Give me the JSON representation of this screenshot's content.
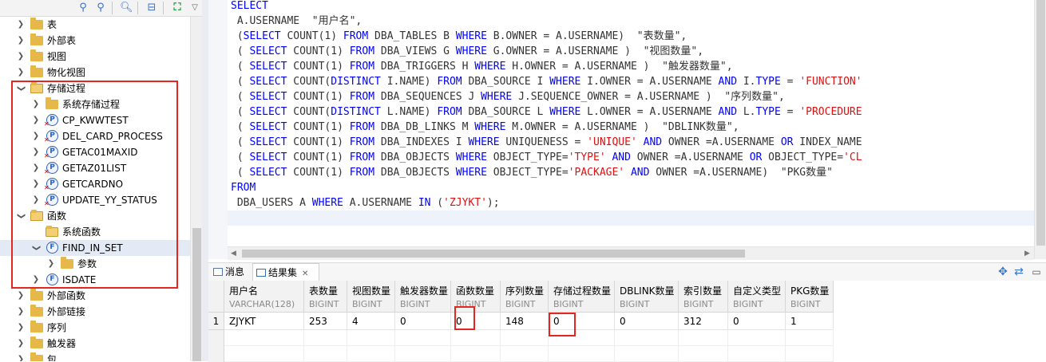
{
  "tree": {
    "items": [
      {
        "label": "表",
        "icon": "folder-icon",
        "expanded": false
      },
      {
        "label": "外部表",
        "icon": "folder-icon",
        "expanded": false
      },
      {
        "label": "视图",
        "icon": "folder-icon",
        "expanded": false
      },
      {
        "label": "物化视图",
        "icon": "folder-icon",
        "expanded": false
      },
      {
        "label": "存储过程",
        "icon": "folder-open-icon",
        "expanded": true
      },
      {
        "label": "系统存储过程",
        "icon": "folder-icon",
        "expanded": false
      },
      {
        "label": "CP_KWWTEST",
        "icon": "procedure-error-icon",
        "expanded": false
      },
      {
        "label": "DEL_CARD_PROCESS",
        "icon": "procedure-error-icon",
        "expanded": false
      },
      {
        "label": "GETAC01MAXID",
        "icon": "procedure-error-icon",
        "expanded": false
      },
      {
        "label": "GETAZ01LIST",
        "icon": "procedure-error-icon",
        "expanded": false
      },
      {
        "label": "GETCARDNO",
        "icon": "procedure-error-icon",
        "expanded": false
      },
      {
        "label": "UPDATE_YY_STATUS",
        "icon": "procedure-error-icon",
        "expanded": false
      },
      {
        "label": "函数",
        "icon": "folder-open-icon",
        "expanded": true
      },
      {
        "label": "系统函数",
        "icon": "folder-open-icon",
        "expanded": false
      },
      {
        "label": "FIND_IN_SET",
        "icon": "function-icon",
        "expanded": true,
        "selected": true
      },
      {
        "label": "参数",
        "icon": "folder-icon",
        "expanded": false
      },
      {
        "label": "ISDATE",
        "icon": "function-icon",
        "expanded": false
      },
      {
        "label": "外部函数",
        "icon": "folder-icon",
        "expanded": false
      },
      {
        "label": "外部链接",
        "icon": "folder-icon",
        "expanded": false
      },
      {
        "label": "序列",
        "icon": "folder-icon",
        "expanded": false
      },
      {
        "label": "触发器",
        "icon": "folder-icon",
        "expanded": false
      },
      {
        "label": "包",
        "icon": "folder-icon",
        "expanded": false
      }
    ]
  },
  "sql": {
    "lines": [
      [
        {
          "k": "kw",
          "t": "SELECT"
        }
      ],
      [
        {
          "k": "txt",
          "t": " A.USERNAME  \"用户名\","
        }
      ],
      [
        {
          "k": "txt",
          "t": " ("
        },
        {
          "k": "kw",
          "t": "SELECT"
        },
        {
          "k": "txt",
          "t": " COUNT(1) "
        },
        {
          "k": "kw",
          "t": "FROM"
        },
        {
          "k": "txt",
          "t": " DBA_TABLES B "
        },
        {
          "k": "kw",
          "t": "WHERE"
        },
        {
          "k": "txt",
          "t": " B.OWNER = A.USERNAME)  \"表数量\","
        }
      ],
      [
        {
          "k": "txt",
          "t": " ( "
        },
        {
          "k": "kw",
          "t": "SELECT"
        },
        {
          "k": "txt",
          "t": " COUNT(1) "
        },
        {
          "k": "kw",
          "t": "FROM"
        },
        {
          "k": "txt",
          "t": " DBA_VIEWS G "
        },
        {
          "k": "kw",
          "t": "WHERE"
        },
        {
          "k": "txt",
          "t": " G.OWNER = A.USERNAME )  \"视图数量\","
        }
      ],
      [
        {
          "k": "txt",
          "t": " ( "
        },
        {
          "k": "kw",
          "t": "SELECT"
        },
        {
          "k": "txt",
          "t": " COUNT(1) "
        },
        {
          "k": "kw",
          "t": "FROM"
        },
        {
          "k": "txt",
          "t": " DBA_TRIGGERS H "
        },
        {
          "k": "kw",
          "t": "WHERE"
        },
        {
          "k": "txt",
          "t": " H.OWNER = A.USERNAME )  \"触发器数量\","
        }
      ],
      [
        {
          "k": "txt",
          "t": " ( "
        },
        {
          "k": "kw",
          "t": "SELECT"
        },
        {
          "k": "txt",
          "t": " COUNT("
        },
        {
          "k": "kw",
          "t": "DISTINCT"
        },
        {
          "k": "txt",
          "t": " I.NAME) "
        },
        {
          "k": "kw",
          "t": "FROM"
        },
        {
          "k": "txt",
          "t": " DBA_SOURCE I "
        },
        {
          "k": "kw",
          "t": "WHERE"
        },
        {
          "k": "txt",
          "t": " I.OWNER = A.USERNAME "
        },
        {
          "k": "kw",
          "t": "AND"
        },
        {
          "k": "txt",
          "t": " I."
        },
        {
          "k": "kw",
          "t": "TYPE"
        },
        {
          "k": "txt",
          "t": " = "
        },
        {
          "k": "str",
          "t": "'FUNCTION'"
        }
      ],
      [
        {
          "k": "txt",
          "t": " ( "
        },
        {
          "k": "kw",
          "t": "SELECT"
        },
        {
          "k": "txt",
          "t": " COUNT(1) "
        },
        {
          "k": "kw",
          "t": "FROM"
        },
        {
          "k": "txt",
          "t": " DBA_SEQUENCES J "
        },
        {
          "k": "kw",
          "t": "WHERE"
        },
        {
          "k": "txt",
          "t": " J.SEQUENCE_OWNER = A.USERNAME )  \"序列数量\","
        }
      ],
      [
        {
          "k": "txt",
          "t": " ( "
        },
        {
          "k": "kw",
          "t": "SELECT"
        },
        {
          "k": "txt",
          "t": " COUNT("
        },
        {
          "k": "kw",
          "t": "DISTINCT"
        },
        {
          "k": "txt",
          "t": " L.NAME) "
        },
        {
          "k": "kw",
          "t": "FROM"
        },
        {
          "k": "txt",
          "t": " DBA_SOURCE L "
        },
        {
          "k": "kw",
          "t": "WHERE"
        },
        {
          "k": "txt",
          "t": " L.OWNER = A.USERNAME "
        },
        {
          "k": "kw",
          "t": "AND"
        },
        {
          "k": "txt",
          "t": " L."
        },
        {
          "k": "kw",
          "t": "TYPE"
        },
        {
          "k": "txt",
          "t": " = "
        },
        {
          "k": "str",
          "t": "'PROCEDURE"
        }
      ],
      [
        {
          "k": "txt",
          "t": " ( "
        },
        {
          "k": "kw",
          "t": "SELECT"
        },
        {
          "k": "txt",
          "t": " COUNT(1) "
        },
        {
          "k": "kw",
          "t": "FROM"
        },
        {
          "k": "txt",
          "t": " DBA_DB_LINKS M "
        },
        {
          "k": "kw",
          "t": "WHERE"
        },
        {
          "k": "txt",
          "t": " M.OWNER = A.USERNAME )  \"DBLINK数量\","
        }
      ],
      [
        {
          "k": "txt",
          "t": " ( "
        },
        {
          "k": "kw",
          "t": "SELECT"
        },
        {
          "k": "txt",
          "t": " COUNT(1) "
        },
        {
          "k": "kw",
          "t": "FROM"
        },
        {
          "k": "txt",
          "t": " DBA_INDEXES I "
        },
        {
          "k": "kw",
          "t": "WHERE"
        },
        {
          "k": "txt",
          "t": " UNIQUENESS = "
        },
        {
          "k": "str",
          "t": "'UNIQUE'"
        },
        {
          "k": "txt",
          "t": " "
        },
        {
          "k": "kw",
          "t": "AND"
        },
        {
          "k": "txt",
          "t": " OWNER =A.USERNAME "
        },
        {
          "k": "kw",
          "t": "OR"
        },
        {
          "k": "txt",
          "t": " INDEX_NAME"
        }
      ],
      [
        {
          "k": "txt",
          "t": " ( "
        },
        {
          "k": "kw",
          "t": "SELECT"
        },
        {
          "k": "txt",
          "t": " COUNT(1) "
        },
        {
          "k": "kw",
          "t": "FROM"
        },
        {
          "k": "txt",
          "t": " DBA_OBJECTS "
        },
        {
          "k": "kw",
          "t": "WHERE"
        },
        {
          "k": "txt",
          "t": " OBJECT_TYPE="
        },
        {
          "k": "str",
          "t": "'TYPE'"
        },
        {
          "k": "txt",
          "t": " "
        },
        {
          "k": "kw",
          "t": "AND"
        },
        {
          "k": "txt",
          "t": " OWNER =A.USERNAME "
        },
        {
          "k": "kw",
          "t": "OR"
        },
        {
          "k": "txt",
          "t": " OBJECT_TYPE="
        },
        {
          "k": "str",
          "t": "'CL"
        }
      ],
      [
        {
          "k": "txt",
          "t": " ( "
        },
        {
          "k": "kw",
          "t": "SELECT"
        },
        {
          "k": "txt",
          "t": " COUNT(1) "
        },
        {
          "k": "kw",
          "t": "FROM"
        },
        {
          "k": "txt",
          "t": " DBA_OBJECTS "
        },
        {
          "k": "kw",
          "t": "WHERE"
        },
        {
          "k": "txt",
          "t": " OBJECT_TYPE="
        },
        {
          "k": "str",
          "t": "'PACKAGE'"
        },
        {
          "k": "txt",
          "t": " "
        },
        {
          "k": "kw",
          "t": "AND"
        },
        {
          "k": "txt",
          "t": " OWNER =A.USERNAME)  \"PKG数量\""
        }
      ],
      [
        {
          "k": "kw",
          "t": "FROM"
        }
      ],
      [
        {
          "k": "txt",
          "t": " DBA_USERS A "
        },
        {
          "k": "kw",
          "t": "WHERE"
        },
        {
          "k": "txt",
          "t": " A.USERNAME "
        },
        {
          "k": "kw",
          "t": "IN"
        },
        {
          "k": "txt",
          "t": " ("
        },
        {
          "k": "str",
          "t": "'ZJYKT'"
        },
        {
          "k": "txt",
          "t": ");"
        }
      ],
      [
        {
          "k": "txt",
          "t": ""
        }
      ]
    ]
  },
  "tabs": {
    "messages_label": "消息",
    "results_label": "结果集",
    "close_glyph": "✕"
  },
  "grid": {
    "columns": [
      {
        "name": "用户名",
        "type": "VARCHAR(128)"
      },
      {
        "name": "表数量",
        "type": "BIGINT"
      },
      {
        "name": "视图数量",
        "type": "BIGINT"
      },
      {
        "name": "触发器数量",
        "type": "BIGINT"
      },
      {
        "name": "函数数量",
        "type": "BIGINT"
      },
      {
        "name": "序列数量",
        "type": "BIGINT"
      },
      {
        "name": "存储过程数量",
        "type": "BIGINT"
      },
      {
        "name": "DBLINK数量",
        "type": "BIGINT"
      },
      {
        "name": "索引数量",
        "type": "BIGINT"
      },
      {
        "name": "自定义类型",
        "type": "BIGINT"
      },
      {
        "name": "PKG数量",
        "type": "BIGINT"
      }
    ],
    "rows": [
      {
        "num": "1",
        "cells": [
          "ZJYKT",
          "253",
          "4",
          "0",
          "0",
          "148",
          "0",
          "0",
          "312",
          "0",
          "1"
        ]
      }
    ]
  },
  "colors": {
    "keyword": "#0000ff",
    "string": "#dd1111",
    "highlight_box": "#e4261e",
    "folder": "#e6b84a"
  }
}
